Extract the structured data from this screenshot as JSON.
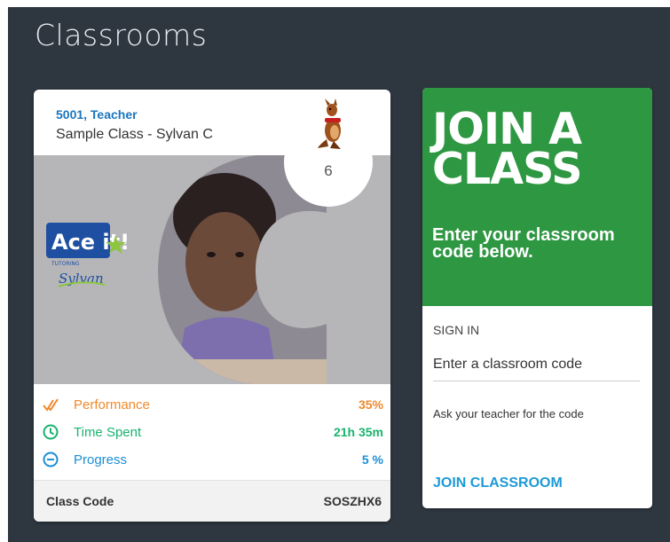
{
  "header": {
    "title": "Classrooms"
  },
  "class_card": {
    "teacher": "5001, Teacher",
    "class_name": "Sample Class - Sylvan C",
    "grade": "6",
    "logo_text": "Ace it!",
    "logo_subtext": "TUTORING",
    "logo_brand": "Sylvan",
    "stats": [
      {
        "label": "Performance",
        "value": "35%",
        "icon": "double-check-icon",
        "color": "#f0892b"
      },
      {
        "label": "Time Spent",
        "value": "21h 35m",
        "icon": "clock-icon",
        "color": "#19b46e"
      },
      {
        "label": "Progress",
        "value": "5 %",
        "icon": "minus-circle-icon",
        "color": "#1c8fd6"
      }
    ],
    "code_label": "Class Code",
    "code_value": "SOSZHX6"
  },
  "join_card": {
    "title": "JOIN A CLASS",
    "subtitle": "Enter your classroom code below.",
    "sign_in_label": "SIGN IN",
    "input_placeholder": "Enter a classroom code",
    "input_value": "",
    "help_text": "Ask your teacher for the code",
    "button_label": "JOIN CLASSROOM",
    "accent_color": "#2e9742",
    "link_color": "#1c9ad6"
  }
}
